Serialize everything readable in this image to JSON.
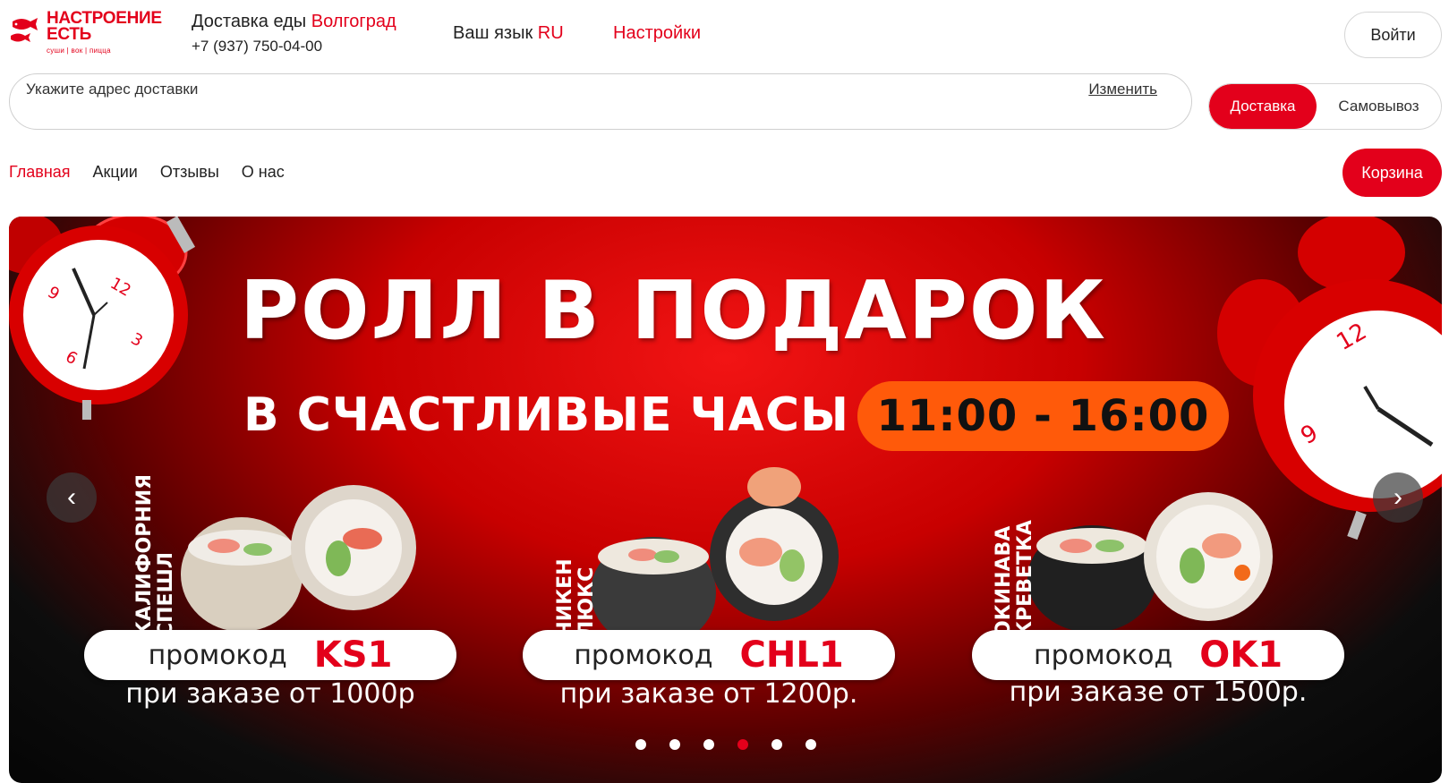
{
  "logo": {
    "title_line1": "НАСТРОЕНИЕ",
    "title_line2": "ЕСТЬ",
    "tagline": "суши | вок | пицца"
  },
  "header": {
    "city_prefix": "Доставка еды",
    "city_name": "Волгоград",
    "phone": "+7 (937) 750-04-00",
    "lang_prefix": "Ваш язык",
    "lang_value": "RU",
    "settings_label": "Настройки",
    "login_label": "Войти"
  },
  "address": {
    "placeholder": "Укажите адрес доставки",
    "change_label": "Изменить"
  },
  "mode_switch": {
    "delivery_label": "Доставка",
    "pickup_label": "Самовывоз",
    "selected": "Доставка"
  },
  "nav": {
    "items": [
      "Главная",
      "Акции",
      "Отзывы",
      "О нас"
    ],
    "active": "Главная"
  },
  "cart": {
    "label": "Корзина"
  },
  "banner": {
    "headline": "РОЛЛ В ПОДАРОК",
    "subline": "В СЧАСТЛИВЫЕ ЧАСЫ",
    "time_range": "11:00 - 16:00",
    "promos": [
      {
        "roll_name_1": "КАЛИФОРНИЯ",
        "roll_name_2": "СПЕШЛ",
        "word": "промокод",
        "code": "KS1",
        "condition": "при заказе от 1000р"
      },
      {
        "roll_name_1": "ЧИКЕН",
        "roll_name_2": "ЛЮКС",
        "word": "промокод",
        "code": "CHL1",
        "condition": "при заказе от 1200р."
      },
      {
        "roll_name_1": "ОКИНАВА",
        "roll_name_2": "КРЕВЕТКА",
        "word": "промокод",
        "code": "OK1",
        "condition": "при заказе от 1500р."
      }
    ],
    "clock_numbers": [
      "12",
      "3",
      "6",
      "9"
    ],
    "prev_arrow": "‹",
    "next_arrow": "›",
    "slide_count": 6,
    "active_slide": 4
  },
  "colors": {
    "accent": "#e3001b",
    "time_pill": "#ff5a0a"
  }
}
